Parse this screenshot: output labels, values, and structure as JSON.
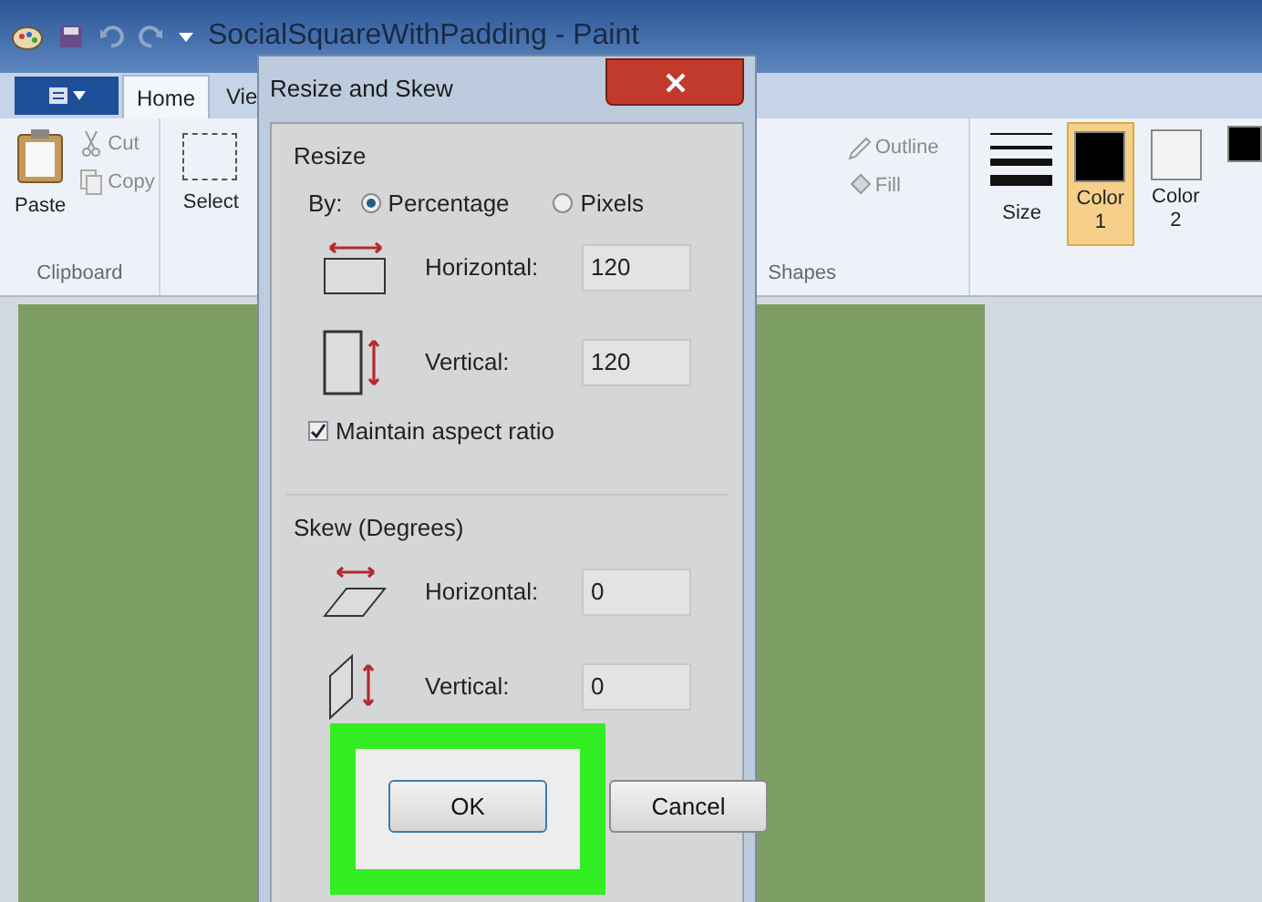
{
  "window": {
    "title": "SocialSquareWithPadding - Paint"
  },
  "ribbon": {
    "tabs": [
      {
        "label": "Home",
        "selected": true
      },
      {
        "label": "Vie",
        "selected": false
      }
    ],
    "clipboard": {
      "label": "Clipboard",
      "paste": "Paste",
      "cut": "Cut",
      "copy": "Copy"
    },
    "image": {
      "select": "Select"
    },
    "shapes": {
      "label": "Shapes",
      "outline": "Outline",
      "fill": "Fill"
    },
    "size": "Size",
    "colors": [
      {
        "label": "Color 1",
        "selected": true,
        "color": "#000000"
      },
      {
        "label": "Color 2",
        "selected": false,
        "color": "#f2f2f2"
      }
    ]
  },
  "dialog": {
    "title": "Resize and Skew",
    "resize": {
      "label": "Resize",
      "by": "By:",
      "units": [
        {
          "label": "Percentage",
          "selected": true
        },
        {
          "label": "Pixels",
          "selected": false
        }
      ],
      "fields": [
        {
          "kind": "horizontal",
          "label": "Horizontal:",
          "value": "120"
        },
        {
          "kind": "vertical",
          "label": "Vertical:",
          "value": "120"
        }
      ],
      "maintain": {
        "label": "Maintain aspect ratio",
        "checked": true
      }
    },
    "skew": {
      "label": "Skew (Degrees)",
      "fields": [
        {
          "kind": "horizontal",
          "label": "Horizontal:",
          "value": "0"
        },
        {
          "kind": "vertical",
          "label": "Vertical:",
          "value": "0"
        }
      ]
    },
    "buttons": [
      {
        "label": "OK",
        "highlighted": true
      },
      {
        "label": "Cancel",
        "highlighted": false
      }
    ]
  }
}
